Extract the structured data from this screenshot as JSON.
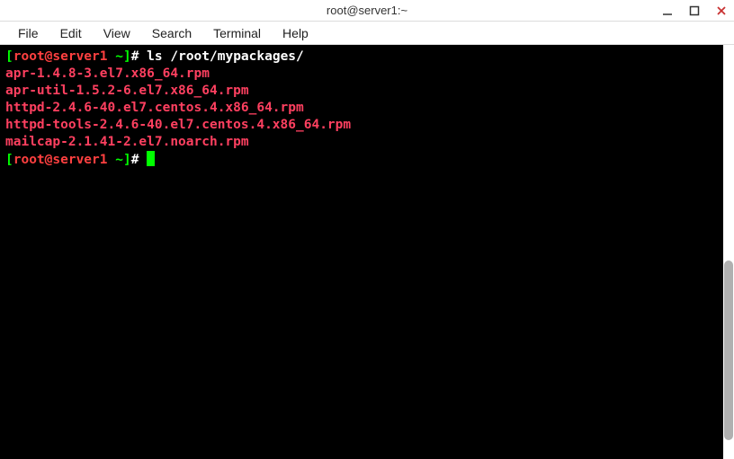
{
  "window": {
    "title": "root@server1:~"
  },
  "menubar": {
    "file": "File",
    "edit": "Edit",
    "view": "View",
    "search": "Search",
    "terminal": "Terminal",
    "help": "Help"
  },
  "terminal": {
    "prompt": {
      "open": "[",
      "userhost": "root@server1",
      "space_tilde": " ~",
      "close": "]",
      "hash": "# "
    },
    "command": "ls /root/mypackages/",
    "files": [
      "apr-1.4.8-3.el7.x86_64.rpm",
      "apr-util-1.5.2-6.el7.x86_64.rpm",
      "httpd-2.4.6-40.el7.centos.4.x86_64.rpm",
      "httpd-tools-2.4.6-40.el7.centos.4.x86_64.rpm",
      "mailcap-2.1.41-2.el7.noarch.rpm"
    ]
  }
}
